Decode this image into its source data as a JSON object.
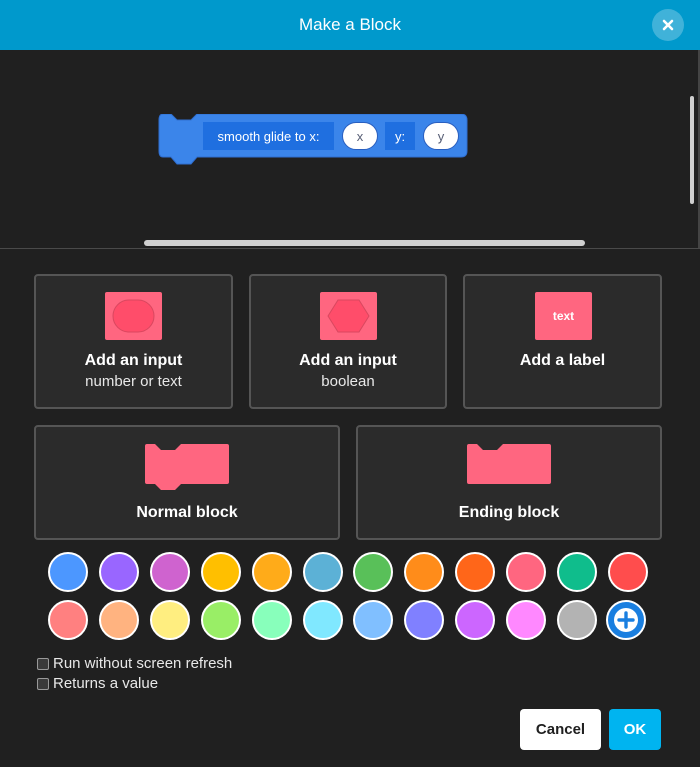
{
  "header": {
    "title": "Make a Block",
    "close_icon": "close-icon"
  },
  "preview": {
    "block": {
      "color": "#3b85ea",
      "segments": [
        {
          "kind": "label",
          "text": "smooth glide to x:"
        },
        {
          "kind": "input",
          "text": "x"
        },
        {
          "kind": "label",
          "text": "y:"
        },
        {
          "kind": "input",
          "text": "y"
        }
      ]
    }
  },
  "options": {
    "input_number": {
      "title": "Add an input",
      "subtitle": "number or text",
      "icon": "round-input-icon"
    },
    "input_boolean": {
      "title": "Add an input",
      "subtitle": "boolean",
      "icon": "hexagon-input-icon"
    },
    "label": {
      "title": "Add a label",
      "icon_text": "text",
      "icon": "label-icon"
    }
  },
  "block_types": {
    "normal": {
      "title": "Normal block",
      "icon": "stack-block-icon"
    },
    "ending": {
      "title": "Ending block",
      "icon": "cap-block-icon"
    }
  },
  "accent_color": "#ff6680",
  "colors": {
    "row1": [
      "#4c97ff",
      "#9966ff",
      "#cf63cf",
      "#ffbf00",
      "#ffab19",
      "#5cb1d6",
      "#59c059",
      "#ff8c1a",
      "#ff6619",
      "#ff6680",
      "#0fbd8c",
      "#ff4d4d"
    ],
    "row2": [
      "#ff8080",
      "#ffb380",
      "#ffee80",
      "#99ee66",
      "#88ffbb",
      "#80e8ff",
      "#80bfff",
      "#8080ff",
      "#cc66ff",
      "#ff88ff",
      "#b3b3b3"
    ],
    "add_icon": "plus-icon"
  },
  "checkboxes": {
    "refresh": {
      "label": "Run without screen refresh",
      "checked": false
    },
    "returns": {
      "label": "Returns a value",
      "checked": false
    }
  },
  "buttons": {
    "cancel": "Cancel",
    "ok": "OK"
  }
}
